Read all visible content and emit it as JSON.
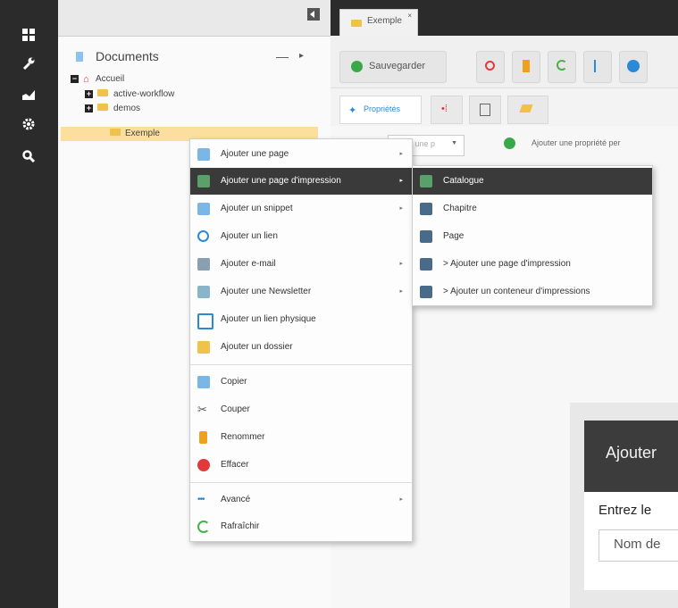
{
  "tree": {
    "title": "Documents",
    "collapse": "—",
    "expand": "▸",
    "nodes": [
      {
        "label": "Accueil"
      },
      {
        "label": "active-workflow"
      },
      {
        "label": "demos"
      },
      {
        "label": "Exemple"
      }
    ]
  },
  "tab": {
    "label": "Exemple",
    "close": "×"
  },
  "toolbar": {
    "save_label": "Sauvegarder"
  },
  "subtabs": {
    "properties": "Propriétés"
  },
  "props": {
    "select_placeholder": "r une p",
    "add_label": "Ajouter une propriété per"
  },
  "context_menu": {
    "items": [
      {
        "label": "Ajouter une page",
        "arrow": "▸"
      },
      {
        "label": "Ajouter une page d'impression",
        "arrow": "▸"
      },
      {
        "label": "Ajouter un snippet",
        "arrow": "▸"
      },
      {
        "label": "Ajouter un lien"
      },
      {
        "label": "Ajouter e-mail",
        "arrow": "▸"
      },
      {
        "label": "Ajouter une Newsletter",
        "arrow": "▸"
      },
      {
        "label": "Ajouter un lien physique"
      },
      {
        "label": "Ajouter un dossier"
      },
      {
        "label": "Copier"
      },
      {
        "label": "Couper"
      },
      {
        "label": "Renommer"
      },
      {
        "label": "Effacer"
      },
      {
        "label": "Avancé",
        "arrow": "▸"
      },
      {
        "label": "Rafraîchir"
      }
    ]
  },
  "submenu": {
    "items": [
      {
        "label": "Catalogue"
      },
      {
        "label": "Chapitre"
      },
      {
        "label": "Page"
      },
      {
        "label": "> Ajouter une page d'impression"
      },
      {
        "label": "> Ajouter un conteneur d'impressions"
      }
    ]
  },
  "dialog": {
    "title": "Ajouter",
    "label": "Entrez le",
    "input_placeholder": "Nom de"
  },
  "colors": {
    "rail": "#2b2b2b",
    "highlight": "#3a3a3a",
    "folder": "#f0c24a",
    "save_green": "#3aa84a",
    "red": "#e03a3a",
    "blue": "#2a8ad8"
  }
}
